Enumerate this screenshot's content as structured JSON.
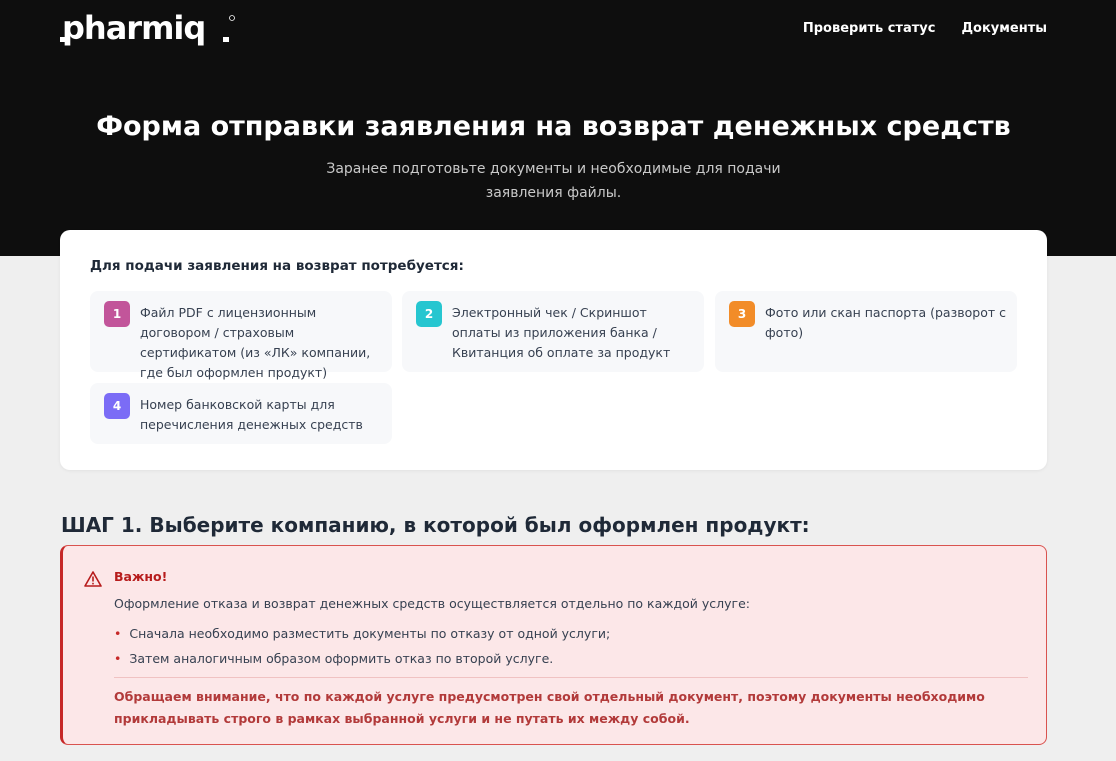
{
  "header": {
    "logo_text": "pharmiq",
    "nav": [
      {
        "label": "Проверить статус"
      },
      {
        "label": "Документы"
      }
    ],
    "title": "Форма отправки заявления на возврат денежных средств",
    "subtitle": "Заранее подготовьте документы и необходимые для подачи заявления файлы."
  },
  "requirements": {
    "title": "Для подачи заявления на возврат потребуется:",
    "items": [
      {
        "num": "1",
        "color": "#c2559a",
        "text": "Файл PDF с лицензионным договором / страховым сертификатом (из «ЛК» компании, где был оформлен продукт)"
      },
      {
        "num": "2",
        "color": "#26c6d0",
        "text": "Электронный чек / Скриншот оплаты из приложения банка / Квитанция об оплате за продукт"
      },
      {
        "num": "3",
        "color": "#f28c28",
        "text": "Фото или скан паспорта (разворот с фото)"
      },
      {
        "num": "4",
        "color": "#7b6cf6",
        "text": "Номер банковской карты для перечисления денежных средств"
      }
    ]
  },
  "step1": {
    "title": "ШАГ 1. Выберите компанию, в которой был оформлен продукт:"
  },
  "alert": {
    "icon": "warning-icon",
    "title": "Важно!",
    "body": "Оформление отказа и возврат денежных средств осуществляется отдельно по каждой услуге:",
    "bullets": [
      "Сначала необходимо разместить документы по отказу от одной услуги;",
      "Затем аналогичным образом оформить отказ по второй услуге."
    ],
    "note": "Обращаем внимание, что по каждой услуге предусмотрен свой отдельный документ, поэтому документы необходимо прикладывать строго в рамках выбранной услуги и не путать их между собой."
  }
}
